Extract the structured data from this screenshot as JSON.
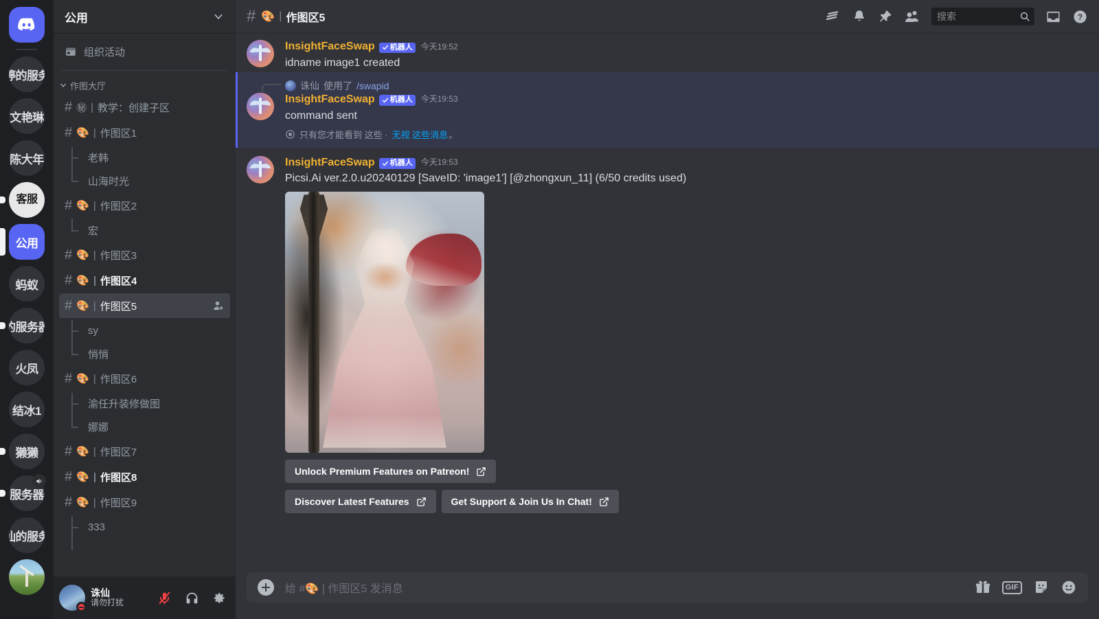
{
  "servers": [
    {
      "name": "discord-home",
      "label": "",
      "type": "home",
      "indicator": "none"
    },
    {
      "name": "婷的服务",
      "label": "婷的服务",
      "type": "text",
      "indicator": "none"
    },
    {
      "name": "文艳琳",
      "label": "文艳琳",
      "type": "text",
      "indicator": "none"
    },
    {
      "name": "陈大年",
      "label": "陈大年",
      "type": "text",
      "indicator": "none"
    },
    {
      "name": "客服",
      "label": "客服",
      "type": "white",
      "indicator": "sm"
    },
    {
      "name": "公用",
      "label": "公用",
      "type": "active",
      "indicator": "lg"
    },
    {
      "name": "蚂蚁",
      "label": "蚂蚁",
      "type": "text",
      "indicator": "none"
    },
    {
      "name": "的服务器",
      "label": "的服务器",
      "type": "text",
      "indicator": "sm"
    },
    {
      "name": "火凤",
      "label": "火凤",
      "type": "text",
      "indicator": "none"
    },
    {
      "name": "结冰1",
      "label": "结冰1",
      "type": "text",
      "indicator": "none"
    },
    {
      "name": "獭獭",
      "label": "獭獭",
      "type": "text",
      "indicator": "sm"
    },
    {
      "name": "服务器-voice",
      "label": "服务器",
      "type": "text",
      "indicator": "sm",
      "voice": true
    },
    {
      "name": "仙的服务",
      "label": "仙的服务",
      "type": "text",
      "indicator": "none"
    },
    {
      "name": "windmill-server",
      "label": "",
      "type": "photo",
      "indicator": "none"
    }
  ],
  "sidebar": {
    "server_name": "公用",
    "events_label": "组织活动",
    "category": "作图大厅",
    "channels": [
      {
        "kind": "channel",
        "emoji": "㊙",
        "label": "教学：创建子区",
        "state": "normal"
      },
      {
        "kind": "channel",
        "emoji": "🎨",
        "label": "作图区1",
        "state": "normal"
      },
      {
        "kind": "thread",
        "label": "老韩",
        "position": "first"
      },
      {
        "kind": "thread",
        "label": "山海时光",
        "position": "last"
      },
      {
        "kind": "channel",
        "emoji": "🎨",
        "label": "作图区2",
        "state": "normal"
      },
      {
        "kind": "thread",
        "label": "宏",
        "position": "last"
      },
      {
        "kind": "channel",
        "emoji": "🎨",
        "label": "作图区3",
        "state": "normal"
      },
      {
        "kind": "channel",
        "emoji": "🎨",
        "label": "作图区4",
        "state": "unread"
      },
      {
        "kind": "channel",
        "emoji": "🎨",
        "label": "作图区5",
        "state": "selected"
      },
      {
        "kind": "thread",
        "label": "sy",
        "position": "first"
      },
      {
        "kind": "thread",
        "label": "悄悄",
        "position": "last"
      },
      {
        "kind": "channel",
        "emoji": "🎨",
        "label": "作图区6",
        "state": "normal"
      },
      {
        "kind": "thread",
        "label": "渝任升装修做图",
        "position": "first"
      },
      {
        "kind": "thread",
        "label": "娜娜",
        "position": "last"
      },
      {
        "kind": "channel",
        "emoji": "🎨",
        "label": "作图区7",
        "state": "normal"
      },
      {
        "kind": "channel",
        "emoji": "🎨",
        "label": "作图区8",
        "state": "unread"
      },
      {
        "kind": "channel",
        "emoji": "🎨",
        "label": "作图区9",
        "state": "normal"
      },
      {
        "kind": "thread",
        "label": "333",
        "position": "first"
      }
    ]
  },
  "user_panel": {
    "name": "诛仙",
    "status": "请勿打扰",
    "mic_icon": "microphone-muted-icon",
    "headset_icon": "headset-icon",
    "settings_icon": "gear-icon"
  },
  "topbar": {
    "channel_emoji": "🎨",
    "separator": "|",
    "channel_name": "作图区5",
    "icons": [
      "threads-icon",
      "bell-icon",
      "pin-icon",
      "members-icon"
    ],
    "search_placeholder": "搜索",
    "inbox_icon": "inbox-icon",
    "help_icon": "help-icon"
  },
  "messages": [
    {
      "author": "InsightFaceSwap",
      "bot_tag": "机器人",
      "timestamp": "今天19:52",
      "text": "idname image1 created",
      "highlight": false
    },
    {
      "reply": {
        "user": "诛仙",
        "action": "使用了",
        "command": "/swapid"
      },
      "author": "InsightFaceSwap",
      "bot_tag": "机器人",
      "timestamp": "今天19:53",
      "text": "command sent",
      "ephemeral_prefix": "只有您才能看到 这些 ·",
      "ephemeral_link": "无视 这些消息",
      "ephemeral_suffix": "。",
      "highlight": true
    },
    {
      "author": "InsightFaceSwap",
      "bot_tag": "机器人",
      "timestamp": "今天19:53",
      "text": "Picsi.Ai ver.2.0.u20240129 [SaveID: 'image1'] [@zhongxun_11] (6/50 credits used)",
      "has_image": true,
      "highlight": false
    }
  ],
  "action_buttons": [
    {
      "label": "Unlock Premium Features on Patreon!",
      "icon": "external-link-icon",
      "row": 1
    },
    {
      "label": "Discover Latest Features",
      "icon": "external-link-icon",
      "row": 2
    },
    {
      "label": "Get Support & Join Us In Chat!",
      "icon": "external-link-icon",
      "row": 2
    }
  ],
  "composer": {
    "placeholder_prefix": "给 #",
    "placeholder_emoji": "🎨",
    "placeholder_sep": "|",
    "placeholder_channel": "作图区5",
    "placeholder_suffix": "发消息",
    "icons": [
      "gift-icon",
      "gif-icon",
      "sticker-icon",
      "emoji-icon"
    ],
    "gif_label": "GIF"
  },
  "colors": {
    "brand": "#5865f2",
    "bot_name": "#f0b132",
    "link": "#00a8fc",
    "bg_main": "#313338",
    "bg_sidebar": "#2b2d31",
    "bg_rail": "#1e1f22"
  }
}
